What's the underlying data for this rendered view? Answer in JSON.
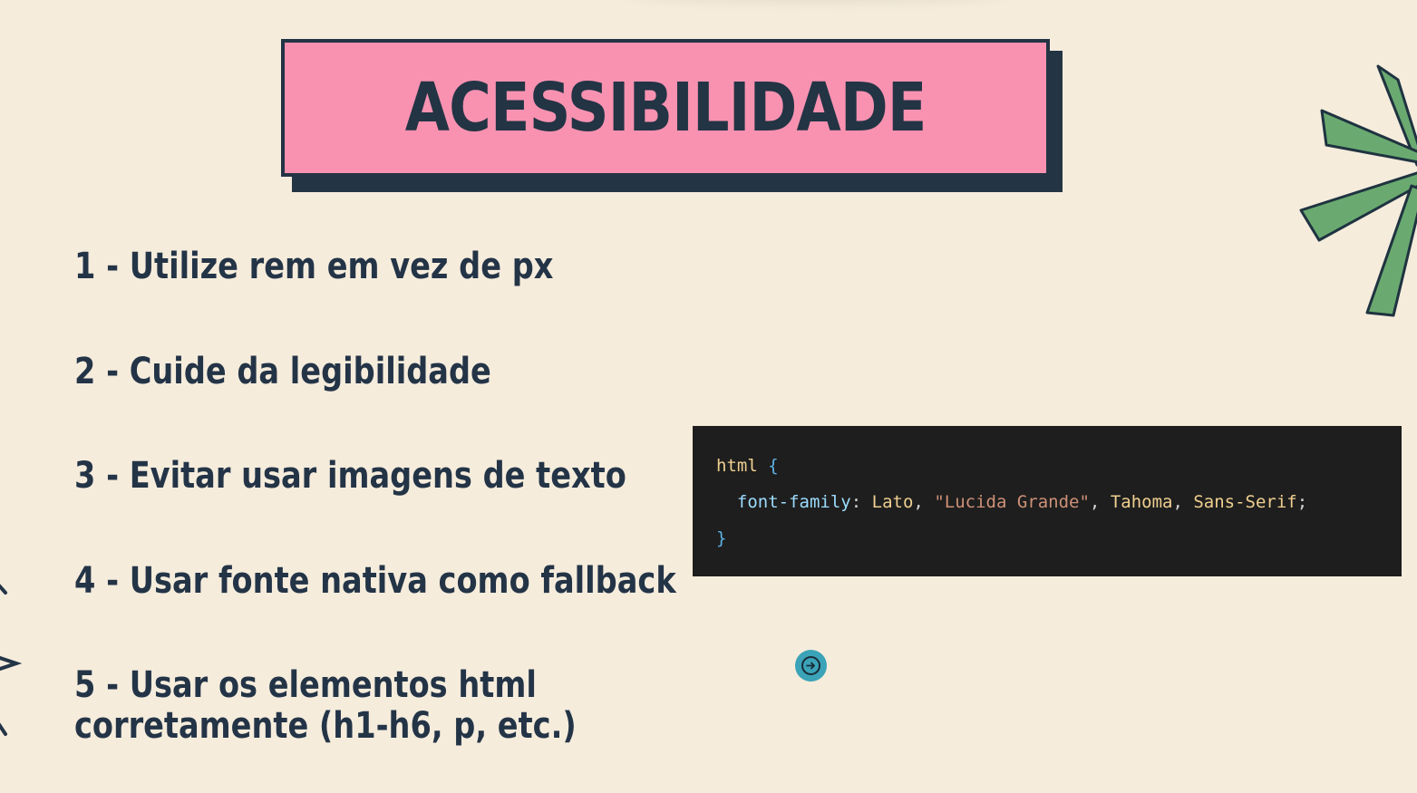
{
  "slide": {
    "title": "ACESSIBILIDADE",
    "items": [
      "1 - Utilize rem em vez de px",
      "2 - Cuide da legibilidade",
      "3 - Evitar usar imagens de texto",
      "4 - Usar fonte nativa como fallback"
    ],
    "item5_line1": "5 - Usar os elementos html",
    "item5_line2": "corretamente (h1-h6, p, etc.)"
  },
  "code": {
    "selector": "html",
    "open_brace": "{",
    "property": "font-family",
    "colon": ":",
    "val_1": "Lato",
    "comma_1": ",",
    "val_2": "\"Lucida Grande\"",
    "comma_2": ",",
    "val_3": "Tahoma",
    "comma_3": ",",
    "val_4": "Sans-Serif",
    "semicolon": ";",
    "close_brace": "}"
  },
  "icons": {
    "nav": "arrow-right-icon",
    "star": "star-icon",
    "left": "arrow-decoration-icon"
  },
  "colors": {
    "background": "#f5ecdc",
    "title_bg": "#f992b1",
    "dark": "#233444",
    "accent_green": "#6aaa70",
    "nav_button": "#3aa3b8",
    "code_bg": "#1e1e1e"
  }
}
